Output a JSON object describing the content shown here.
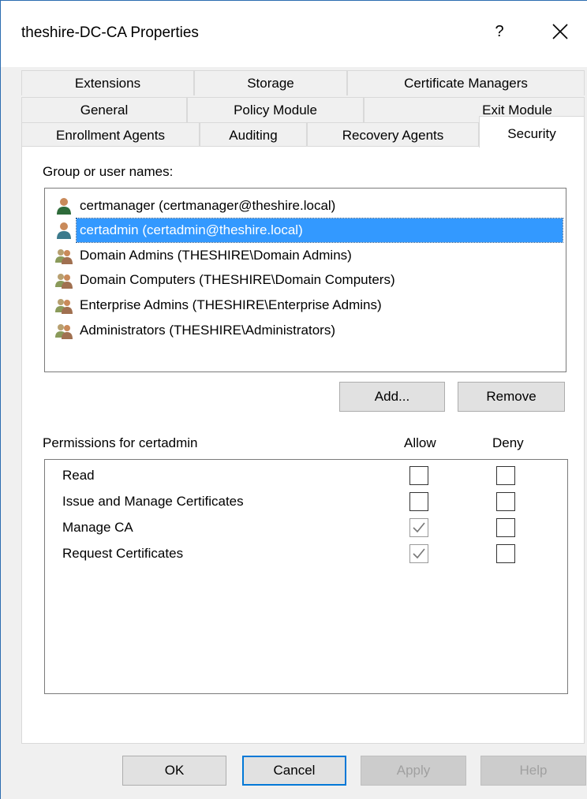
{
  "window": {
    "title": "theshire-DC-CA Properties",
    "help_label": "?"
  },
  "tabs": {
    "row1": [
      "Extensions",
      "Storage",
      "Certificate Managers"
    ],
    "row2": [
      "General",
      "Policy Module",
      "Exit Module"
    ],
    "row3": [
      "Enrollment Agents",
      "Auditing",
      "Recovery Agents",
      "Security"
    ],
    "active": "Security"
  },
  "security": {
    "group_label": "Group or user names:",
    "users": [
      {
        "name": "certmanager (certmanager@theshire.local)",
        "icon": "user-icon",
        "selected": false
      },
      {
        "name": "certadmin (certadmin@theshire.local)",
        "icon": "user-icon",
        "selected": true
      },
      {
        "name": "Domain Admins (THESHIRE\\Domain Admins)",
        "icon": "group-icon",
        "selected": false
      },
      {
        "name": "Domain Computers (THESHIRE\\Domain Computers)",
        "icon": "group-icon",
        "selected": false
      },
      {
        "name": "Enterprise Admins (THESHIRE\\Enterprise Admins)",
        "icon": "group-icon",
        "selected": false
      },
      {
        "name": "Administrators (THESHIRE\\Administrators)",
        "icon": "group-icon",
        "selected": false
      }
    ],
    "add_label": "Add...",
    "remove_label": "Remove",
    "permissions_label": "Permissions for certadmin",
    "allow_label": "Allow",
    "deny_label": "Deny",
    "permissions": [
      {
        "name": "Read",
        "allow": false,
        "deny": false
      },
      {
        "name": "Issue and Manage Certificates",
        "allow": false,
        "deny": false
      },
      {
        "name": "Manage CA",
        "allow": true,
        "deny": false
      },
      {
        "name": "Request Certificates",
        "allow": true,
        "deny": false
      }
    ]
  },
  "footer": {
    "ok_label": "OK",
    "cancel_label": "Cancel",
    "apply_label": "Apply",
    "help_label": "Help"
  },
  "colors": {
    "selection": "#3399ff",
    "accent": "#0078d7"
  }
}
